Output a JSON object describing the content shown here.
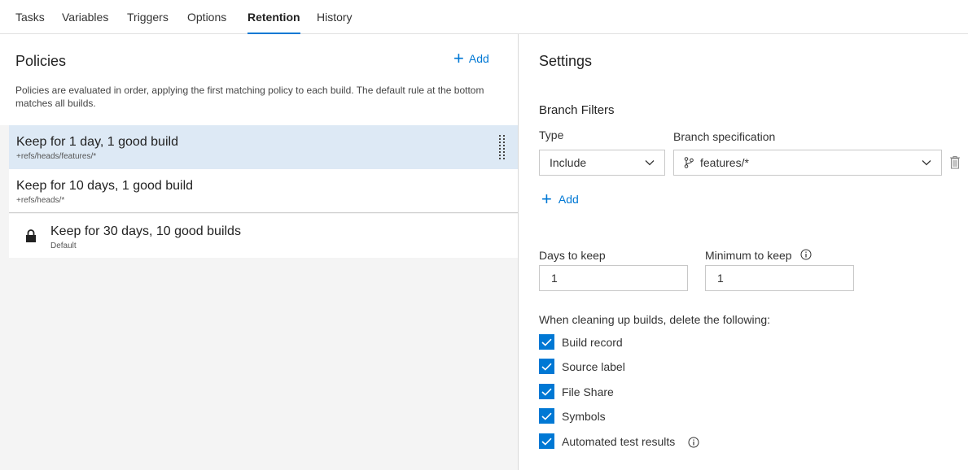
{
  "tabs": [
    {
      "label": "Tasks"
    },
    {
      "label": "Variables"
    },
    {
      "label": "Triggers"
    },
    {
      "label": "Options"
    },
    {
      "label": "Retention",
      "active": true
    },
    {
      "label": "History"
    }
  ],
  "policies": {
    "title": "Policies",
    "add_label": "Add",
    "description": "Policies are evaluated in order, applying the first matching policy to each build. The default rule at the bottom matches all builds.",
    "items": [
      {
        "title": "Keep for 1 day, 1 good build",
        "subtitle": "+refs/heads/features/*",
        "selected": true
      },
      {
        "title": "Keep for 10 days, 1 good build",
        "subtitle": "+refs/heads/*"
      },
      {
        "title": "Keep for 30 days, 10 good builds",
        "subtitle": "Default",
        "icon": "lock-icon"
      }
    ]
  },
  "settings": {
    "title": "Settings",
    "branch_filters": {
      "title": "Branch Filters",
      "type_label": "Type",
      "type_value": "Include",
      "spec_label": "Branch specification",
      "spec_value": "features/*",
      "add_label": "Add"
    },
    "days_label": "Days to keep",
    "days_value": "1",
    "min_label": "Minimum to keep",
    "min_value": "1",
    "cleanup_label": "When cleaning up builds, delete the following:",
    "checkboxes": [
      {
        "label": "Build record",
        "checked": true
      },
      {
        "label": "Source label",
        "checked": true
      },
      {
        "label": "File Share",
        "checked": true
      },
      {
        "label": "Symbols",
        "checked": true
      },
      {
        "label": "Automated test results",
        "checked": true
      }
    ]
  },
  "colors": {
    "accent": "#0078d4",
    "selected_bg": "#dde9f5",
    "panel_bg": "#f4f4f4"
  }
}
